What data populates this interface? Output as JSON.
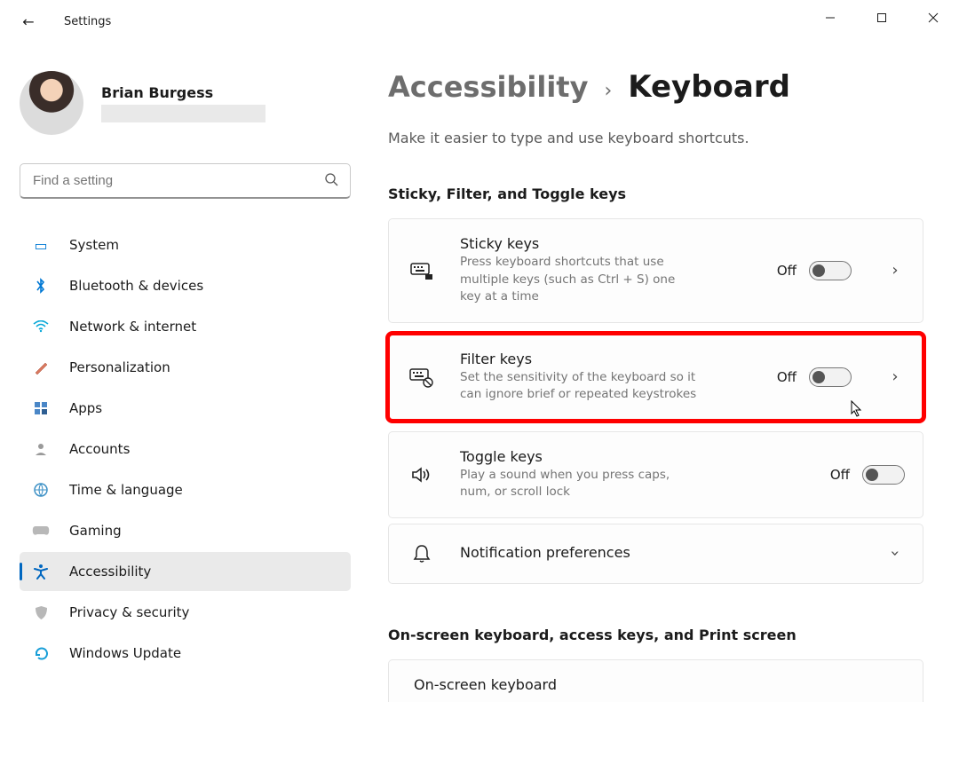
{
  "titlebar": {
    "app_title": "Settings"
  },
  "profile": {
    "name": "Brian Burgess"
  },
  "search": {
    "placeholder": "Find a setting"
  },
  "sidebar": {
    "items": [
      {
        "label": "System"
      },
      {
        "label": "Bluetooth & devices"
      },
      {
        "label": "Network & internet"
      },
      {
        "label": "Personalization"
      },
      {
        "label": "Apps"
      },
      {
        "label": "Accounts"
      },
      {
        "label": "Time & language"
      },
      {
        "label": "Gaming"
      },
      {
        "label": "Accessibility"
      },
      {
        "label": "Privacy & security"
      },
      {
        "label": "Windows Update"
      }
    ]
  },
  "breadcrumb": {
    "parent": "Accessibility",
    "sep": "›",
    "current": "Keyboard"
  },
  "subtitle": "Make it easier to type and use keyboard shortcuts.",
  "section1": {
    "header": "Sticky, Filter, and Toggle keys"
  },
  "cards": {
    "sticky": {
      "title": "Sticky keys",
      "desc": "Press keyboard shortcuts that use multiple keys (such as Ctrl + S) one key at a time",
      "state": "Off"
    },
    "filter": {
      "title": "Filter keys",
      "desc": "Set the sensitivity of the keyboard so it can ignore brief or repeated keystrokes",
      "state": "Off"
    },
    "toggle": {
      "title": "Toggle keys",
      "desc": "Play a sound when you press caps, num, or scroll lock",
      "state": "Off"
    },
    "notif": {
      "title": "Notification preferences"
    }
  },
  "section2": {
    "header": "On-screen keyboard, access keys, and Print screen"
  },
  "cards2": {
    "osk": {
      "title": "On-screen keyboard"
    }
  }
}
